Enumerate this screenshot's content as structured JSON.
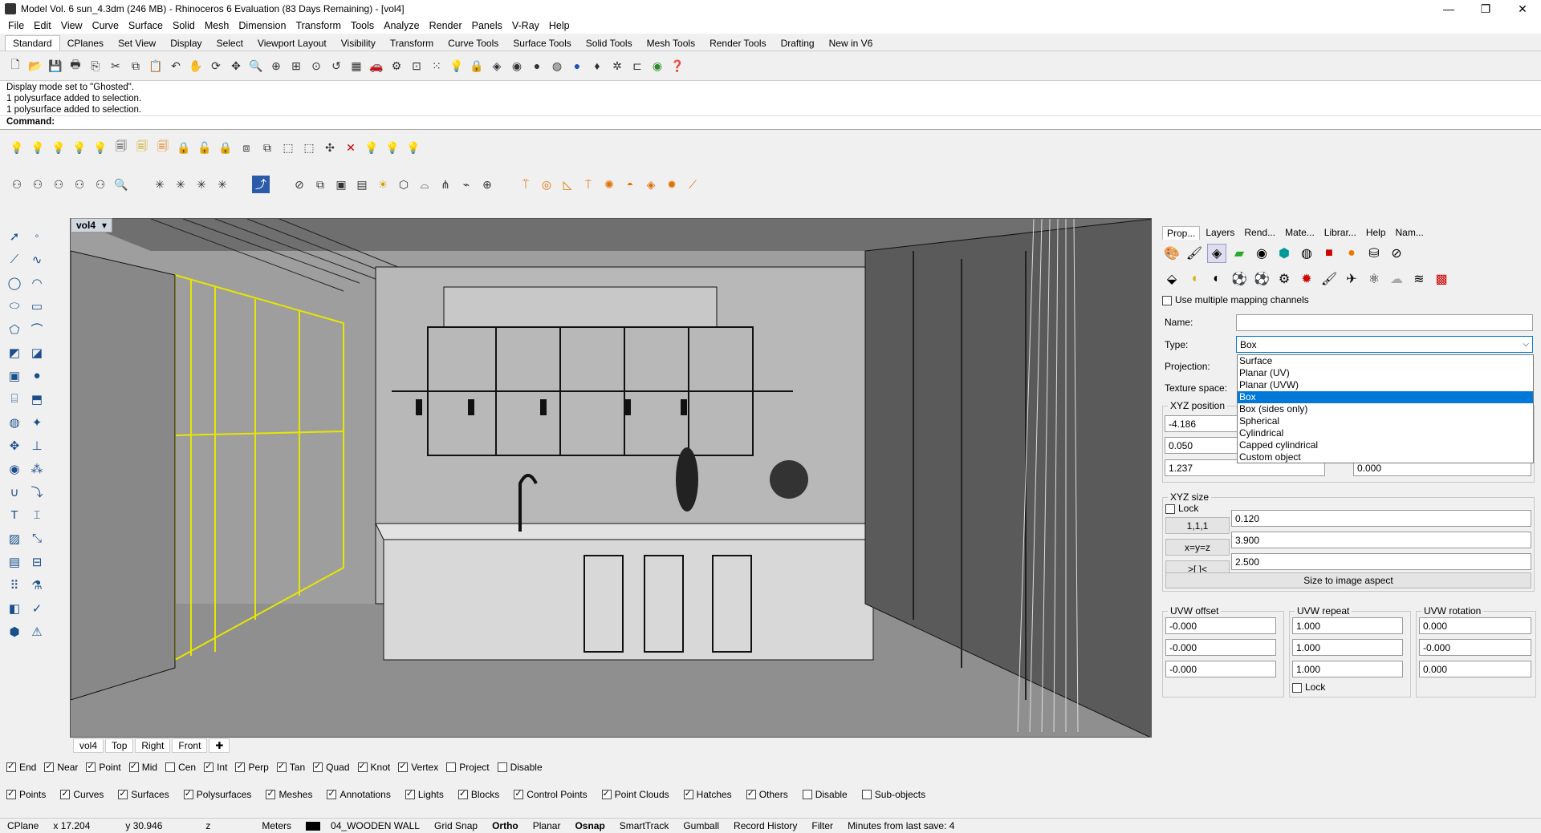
{
  "window": {
    "title": "Model Vol. 6 sun_4.3dm (246 MB) - Rhinoceros 6 Evaluation (83 Days Remaining) - [vol4]",
    "controls": [
      "—",
      "❐",
      "✕"
    ]
  },
  "menu": [
    "File",
    "Edit",
    "View",
    "Curve",
    "Surface",
    "Solid",
    "Mesh",
    "Dimension",
    "Transform",
    "Tools",
    "Analyze",
    "Render",
    "Panels",
    "V-Ray",
    "Help"
  ],
  "tabs": [
    "Standard",
    "CPlanes",
    "Set View",
    "Display",
    "Select",
    "Viewport Layout",
    "Visibility",
    "Transform",
    "Curve Tools",
    "Surface Tools",
    "Solid Tools",
    "Mesh Tools",
    "Render Tools",
    "Drafting",
    "New in V6"
  ],
  "active_tab": "Standard",
  "command_history": [
    "Display mode set to \"Ghosted\".",
    "1 polysurface added to selection.",
    "1 polysurface added to selection."
  ],
  "command_label": "Command:",
  "viewport": {
    "name": "vol4",
    "bottom_tabs": [
      "vol4",
      "Top",
      "Right",
      "Front"
    ]
  },
  "panel": {
    "tabs": [
      "Prop...",
      "Layers",
      "Rend...",
      "Mate...",
      "Librar...",
      "Help",
      "Nam..."
    ],
    "use_multiple_channels": "Use multiple mapping channels",
    "name_label": "Name:",
    "name_value": "",
    "type_label": "Type:",
    "type_value": "Box",
    "projection_label": "Projection:",
    "texture_space_label": "Texture space:",
    "xyz_position_label": "XYZ position",
    "pos_x": "-4.186",
    "pos_y": "0.050",
    "pos_z": "1.237",
    "rot_z": "0.000",
    "type_options": [
      "Surface",
      "Planar (UV)",
      "Planar (UVW)",
      "Box",
      "Box (sides only)",
      "Spherical",
      "Cylindrical",
      "Capped cylindrical",
      "Custom object"
    ],
    "type_selected_index": 3,
    "xyz_size_label": "XYZ size",
    "lock_label": "Lock",
    "size_btn1": "1,1,1",
    "size_btn2": "x=y=z",
    "size_btn3": ">[ ]<",
    "size_x": "0.120",
    "size_y": "3.900",
    "size_z": "2.500",
    "size_to_image": "Size to image aspect",
    "uvw_offset_label": "UVW offset",
    "uvw_repeat_label": "UVW repeat",
    "uvw_rotation_label": "UVW rotation",
    "offset": [
      "-0.000",
      "-0.000",
      "-0.000"
    ],
    "repeat": [
      "1.000",
      "1.000",
      "1.000"
    ],
    "rotation": [
      "0.000",
      "-0.000",
      "0.000"
    ],
    "repeat_lock_label": "Lock"
  },
  "osnap": [
    {
      "label": "End",
      "on": true
    },
    {
      "label": "Near",
      "on": true
    },
    {
      "label": "Point",
      "on": true
    },
    {
      "label": "Mid",
      "on": true
    },
    {
      "label": "Cen",
      "on": false
    },
    {
      "label": "Int",
      "on": true
    },
    {
      "label": "Perp",
      "on": true
    },
    {
      "label": "Tan",
      "on": true
    },
    {
      "label": "Quad",
      "on": true
    },
    {
      "label": "Knot",
      "on": true
    },
    {
      "label": "Vertex",
      "on": true
    },
    {
      "label": "Project",
      "on": false
    },
    {
      "label": "Disable",
      "on": false
    }
  ],
  "filters": [
    {
      "label": "Points",
      "on": true
    },
    {
      "label": "Curves",
      "on": true
    },
    {
      "label": "Surfaces",
      "on": true
    },
    {
      "label": "Polysurfaces",
      "on": true
    },
    {
      "label": "Meshes",
      "on": true
    },
    {
      "label": "Annotations",
      "on": true
    },
    {
      "label": "Lights",
      "on": true
    },
    {
      "label": "Blocks",
      "on": true
    },
    {
      "label": "Control Points",
      "on": true
    },
    {
      "label": "Point Clouds",
      "on": true
    },
    {
      "label": "Hatches",
      "on": true
    },
    {
      "label": "Others",
      "on": true
    },
    {
      "label": "Disable",
      "on": false
    },
    {
      "label": "Sub-objects",
      "on": false
    }
  ],
  "status": {
    "cplane": "CPlane",
    "x": "x 17.204",
    "y": "y 30.946",
    "z": "z",
    "units": "Meters",
    "layer": "04_WOODEN WALL",
    "grid_snap": "Grid Snap",
    "ortho": "Ortho",
    "planar": "Planar",
    "osnap": "Osnap",
    "smarttrack": "SmartTrack",
    "gumball": "Gumball",
    "record_history": "Record History",
    "filter": "Filter",
    "save_info": "Minutes from last save: 4"
  },
  "colors": {
    "selection": "#e6e600",
    "viewport_bg": "#9a9a9a",
    "dropdown_highlight": "#0078d7"
  }
}
